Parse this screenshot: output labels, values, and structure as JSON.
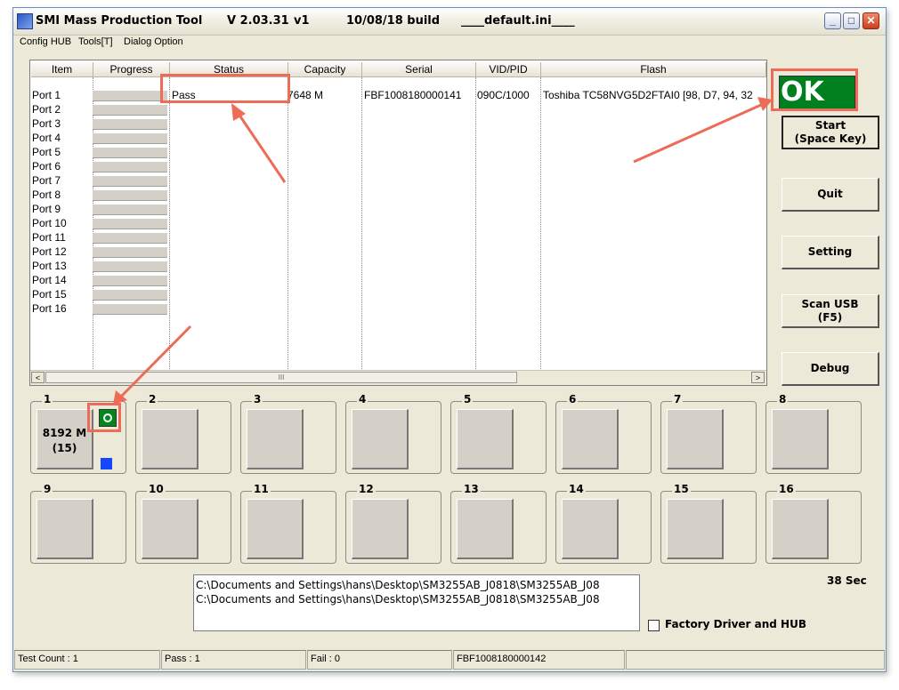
{
  "window": {
    "title": "SMI Mass Production Tool",
    "version": "V 2.03.31",
    "v_label": "v1",
    "build": "10/08/18 build",
    "ini": "____default.ini____",
    "controls": {
      "minimize": "_",
      "maximize": "□",
      "close": "✕"
    }
  },
  "menu": [
    "Config HUB",
    "Tools[T]",
    "Dialog Option"
  ],
  "list": {
    "headers": [
      "Item",
      "Progress",
      "Status",
      "Capacity",
      "Serial",
      "VID/PID",
      "Flash"
    ],
    "ports": [
      "Port 1",
      "Port 2",
      "Port 3",
      "Port 4",
      "Port 5",
      "Port 6",
      "Port 7",
      "Port 8",
      "Port 9",
      "Port 10",
      "Port 11",
      "Port 12",
      "Port 13",
      "Port 14",
      "Port 15",
      "Port 16"
    ],
    "row1": {
      "status": "Pass",
      "capacity": "7648 M",
      "serial": "FBF1008180000141",
      "vidpid": "090C/1000",
      "flash": "Toshiba TC58NVG5D2FTAI0 [98, D7, 94, 32"
    },
    "scroll_left": "<",
    "scroll_right": ">",
    "scroll_thumb": "III"
  },
  "ok_label": "OK",
  "buttons": {
    "start": [
      "Start",
      "(Space Key)"
    ],
    "quit": "Quit",
    "setting": "Setting",
    "scan_usb": [
      "Scan USB",
      "(F5)"
    ],
    "debug": "Debug"
  },
  "port_panels": {
    "numbers": [
      "1",
      "2",
      "3",
      "4",
      "5",
      "6",
      "7",
      "8",
      "9",
      "10",
      "11",
      "12",
      "13",
      "14",
      "15",
      "16"
    ],
    "port1_capacity": "8192 M",
    "port1_count": "(15)"
  },
  "log": [
    "C:\\Documents and Settings\\hans\\Desktop\\SM3255AB_J0818\\SM3255AB_J08",
    "C:\\Documents and Settings\\hans\\Desktop\\SM3255AB_J0818\\SM3255AB_J08"
  ],
  "elapsed": "38 Sec",
  "factory_driver_label": "Factory Driver and HUB",
  "statusbar": {
    "test_count": "Test Count : 1",
    "pass": "Pass : 1",
    "fail": "Fail : 0",
    "serial": "FBF1008180000142",
    "extra": ""
  },
  "colors": {
    "ok_green": "#007f1e",
    "annotation": "#ee6b58",
    "window_bg": "#ece9d8"
  }
}
